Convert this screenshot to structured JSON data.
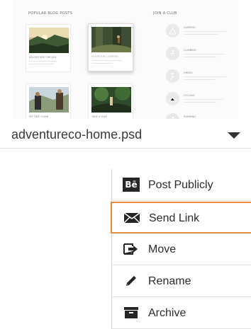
{
  "card": {
    "file_name": "adventureco-home.psd",
    "thumbnail": {
      "posts_heading": "POPULAR BLOG POSTS",
      "clubs_heading": "JOIN A CLUB",
      "posts": [
        {
          "caption": "ADVENTURE CIRCLES"
        },
        {
          "caption": "MOUNTAIN CLIMBING"
        },
        {
          "caption": "MY SIDE CLIMB"
        },
        {
          "caption": "TAKE A HIKE"
        }
      ],
      "clubs": [
        {
          "name": "CAMPING"
        },
        {
          "name": "CLIMBING"
        },
        {
          "name": "HIKING"
        },
        {
          "name": "CYCLING"
        },
        {
          "name": "RUNNING"
        }
      ]
    }
  },
  "menu": {
    "items": [
      {
        "label": "Post Publicly",
        "icon": "behance-icon"
      },
      {
        "label": "Send Link",
        "icon": "envelope-icon",
        "highlighted": true
      },
      {
        "label": "Move",
        "icon": "move-arrow-icon"
      },
      {
        "label": "Rename",
        "icon": "pencil-icon"
      },
      {
        "label": "Archive",
        "icon": "archive-box-icon"
      }
    ],
    "be_logo_text": "Bē"
  },
  "colors": {
    "highlight_border": "#ee8a3b",
    "icon_dark": "#262626",
    "text": "#2c2c2c"
  }
}
